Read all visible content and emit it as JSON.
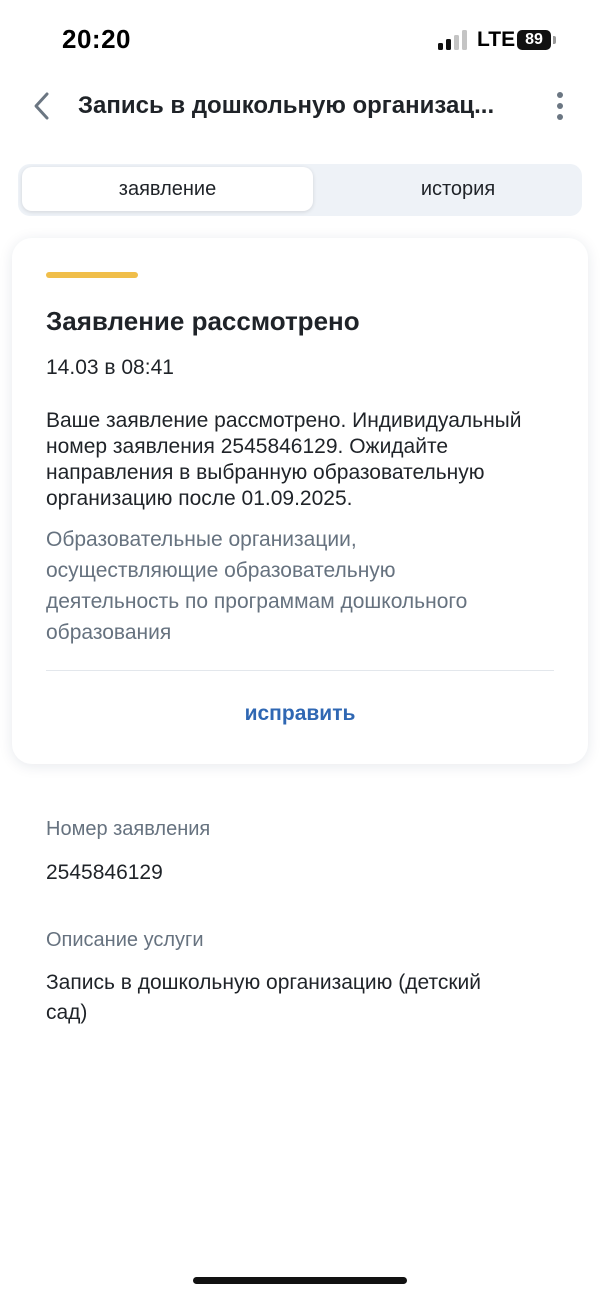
{
  "status_bar": {
    "time": "20:20",
    "network": "LTE",
    "battery": "89",
    "signal_icon": "signal-bars-icon"
  },
  "header": {
    "title": "Запись в дошкольную организац...",
    "back_icon": "chevron-left-icon",
    "more_icon": "more-vertical-icon"
  },
  "tabs": [
    {
      "label": "заявление",
      "active": true
    },
    {
      "label": "история",
      "active": false
    }
  ],
  "status_card": {
    "accent_color": "#f0be4a",
    "title": "Заявление рассмотрено",
    "date": "14.03 в 08:41",
    "message": "Ваше заявление рассмотрено. Индивидуальный номер заявления 2545846129. Ожидайте направления в выбранную образовательную организацию после 01.09.2025.",
    "organization": "Образовательные организации, осуществляющие образовательную деятельность по программам дошкольного образования",
    "edit_label": "исправить",
    "edit_color": "#2f67b3"
  },
  "details": [
    {
      "label": "Номер заявления",
      "value": "2545846129"
    },
    {
      "label": "Описание услуги",
      "value": "Запись в дошкольную организацию (детский сад)"
    }
  ]
}
